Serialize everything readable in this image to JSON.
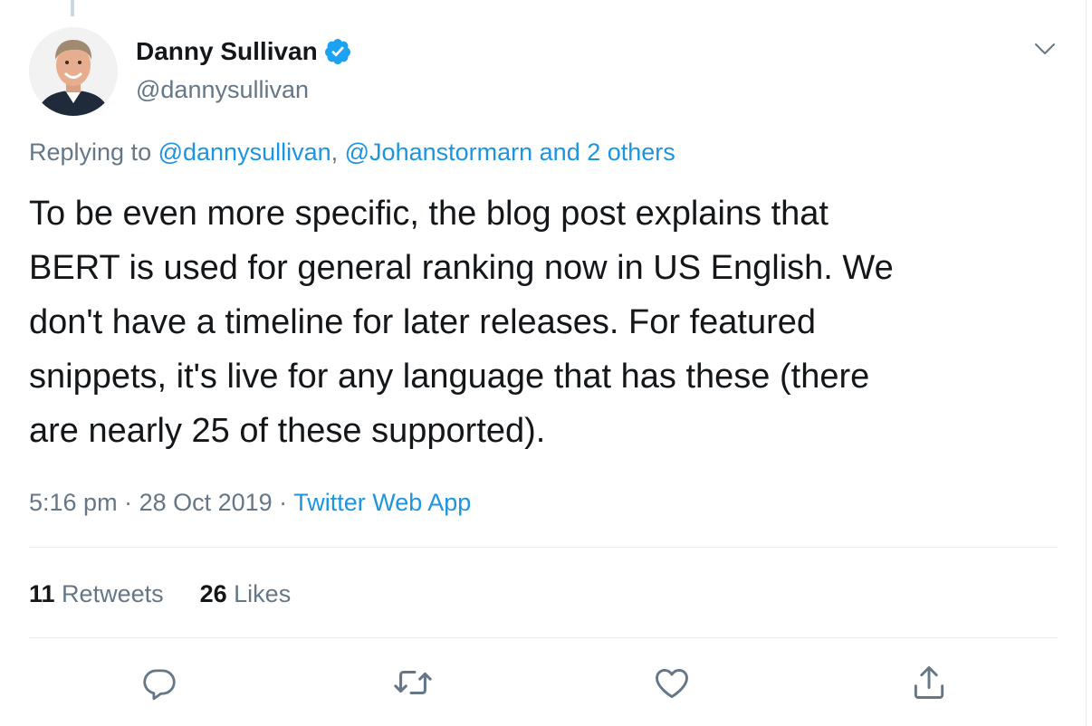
{
  "author": {
    "display_name": "Danny Sullivan",
    "handle": "@dannysullivan",
    "verified": true,
    "avatar_icon": "profile-photo"
  },
  "reply": {
    "prefix": "Replying to ",
    "mention_1": "@dannysullivan",
    "separator": ", ",
    "mention_2": "@Johanstormarn",
    "others": "and 2 others"
  },
  "tweet": {
    "text": "To be even more specific, the blog post explains that\nBERT is used for general ranking now in US English. We\ndon't have a timeline for later releases. For featured\nsnippets, it's live for any language that has these (there\nare nearly 25 of these supported)."
  },
  "meta": {
    "time": "5:16 pm",
    "sep1": " · ",
    "date": "28 Oct 2019",
    "sep2": " · ",
    "source": "Twitter Web App"
  },
  "stats": {
    "retweets_count": "11",
    "retweets_label": " Retweets",
    "likes_count": "26",
    "likes_label": " Likes"
  },
  "actions": {
    "icons": [
      "reply-icon",
      "retweet-icon",
      "like-icon",
      "share-icon"
    ]
  },
  "colors": {
    "link": "#1b95e0",
    "secondary_text": "#657786",
    "primary_text": "#14171a",
    "divider": "#e6ecf0",
    "verified": "#1da1f2"
  }
}
